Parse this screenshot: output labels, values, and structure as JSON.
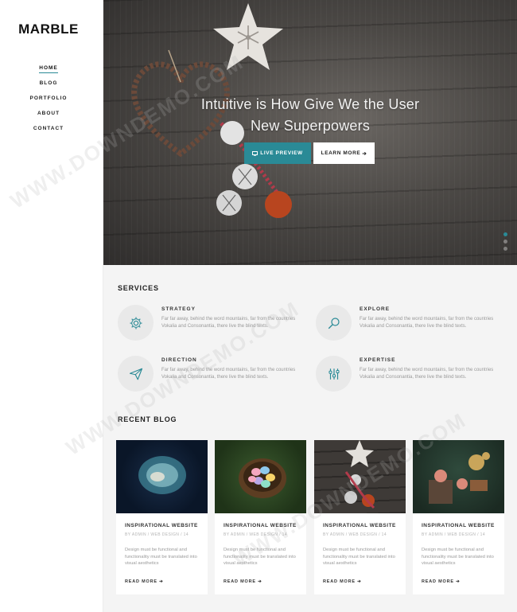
{
  "brand": {
    "logo": "MARBLE"
  },
  "nav": {
    "items": [
      {
        "label": "HOME",
        "active": true
      },
      {
        "label": "BLOG",
        "active": false
      },
      {
        "label": "PORTFOLIO",
        "active": false
      },
      {
        "label": "ABOUT",
        "active": false
      },
      {
        "label": "CONTACT",
        "active": false
      }
    ]
  },
  "hero": {
    "title_line1": "Intuitive is How Give We the User",
    "title_line2": "New Superpowers",
    "primary_button": "LIVE PREVIEW",
    "secondary_button": "LEARN MORE",
    "secondary_arrow": "➔",
    "slides": 3,
    "active_slide": 1
  },
  "services": {
    "title": "SERVICES",
    "items": [
      {
        "title": "STRATEGY",
        "icon": "gear-icon",
        "text": "Far far away, behind the word mountains, far from the countries Vokalia and Consonantia, there live the blind texts."
      },
      {
        "title": "EXPLORE",
        "icon": "search-icon",
        "text": "Far far away, behind the word mountains, far from the countries Vokalia and Consonantia, there live the blind texts."
      },
      {
        "title": "DIRECTION",
        "icon": "paper-plane-icon",
        "text": "Far far away, behind the word mountains, far from the countries Vokalia and Consonantia, there live the blind texts."
      },
      {
        "title": "EXPERTISE",
        "icon": "sliders-icon",
        "text": "Far far away, behind the word mountains, far from the countries Vokalia and Consonantia, there live the blind texts."
      }
    ]
  },
  "blog": {
    "title": "RECENT BLOG",
    "cards": [
      {
        "title": "INSPIRATIONAL WEBSITE",
        "meta": "BY ADMIN / WEB DESIGN / 14",
        "text": "Design must be functional and functionality must be translated into visual aesthetics",
        "more": "READ MORE",
        "image": "jellyfish"
      },
      {
        "title": "INSPIRATIONAL WEBSITE",
        "meta": "BY ADMIN / WEB DESIGN / 14",
        "text": "Design must be functional and functionality must be translated into visual aesthetics",
        "more": "READ MORE",
        "image": "eggs-in-nest"
      },
      {
        "title": "INSPIRATIONAL WEBSITE",
        "meta": "BY ADMIN / WEB DESIGN / 14",
        "text": "Design must be functional and functionality must be translated into visual aesthetics",
        "more": "READ MORE",
        "image": "christmas-ornaments"
      },
      {
        "title": "INSPIRATIONAL WEBSITE",
        "meta": "BY ADMIN / WEB DESIGN / 14",
        "text": "Design must be functional and functionality must be translated into visual aesthetics",
        "more": "READ MORE",
        "image": "craft-tools"
      }
    ]
  },
  "watermark": "WWW.DOWNDEMO.COM",
  "colors": {
    "accent": "#2a8a96",
    "sidebar_bg": "#ffffff",
    "page_bg": "#f4f4f4"
  }
}
